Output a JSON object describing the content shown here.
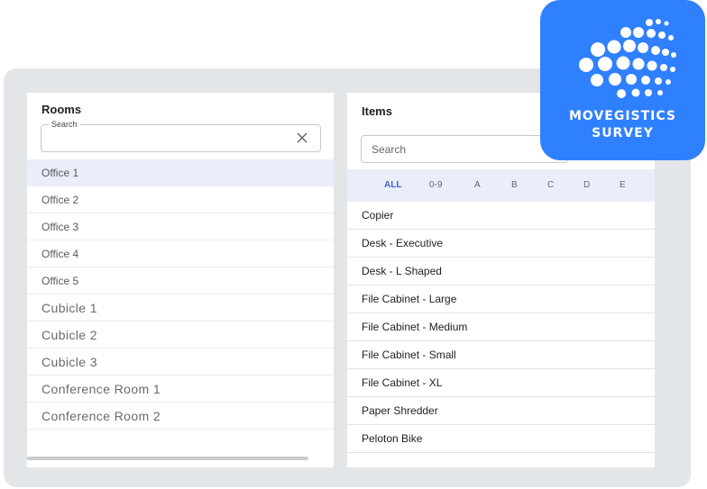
{
  "rooms_panel": {
    "title": "Rooms",
    "search_legend": "Search",
    "rooms": [
      {
        "label": "Office 1",
        "selected": true,
        "style": "small"
      },
      {
        "label": "Office 2",
        "selected": false,
        "style": "small"
      },
      {
        "label": "Office 3",
        "selected": false,
        "style": "small"
      },
      {
        "label": "Office 4",
        "selected": false,
        "style": "small"
      },
      {
        "label": "Office 5",
        "selected": false,
        "style": "small"
      },
      {
        "label": "Cubicle 1",
        "selected": false,
        "style": "big"
      },
      {
        "label": "Cubicle 2",
        "selected": false,
        "style": "big"
      },
      {
        "label": "Cubicle 3",
        "selected": false,
        "style": "big"
      },
      {
        "label": "Conference Room 1",
        "selected": false,
        "style": "big"
      },
      {
        "label": "Conference Room 2",
        "selected": false,
        "style": "big"
      }
    ]
  },
  "items_panel": {
    "title": "Items",
    "search_placeholder": "Search",
    "alpha_filters": [
      "ALL",
      "0-9",
      "A",
      "B",
      "C",
      "D",
      "E"
    ],
    "active_filter": "ALL",
    "items": [
      "Copier",
      "Desk - Executive",
      "Desk - L Shaped",
      "File Cabinet - Large",
      "File Cabinet - Medium",
      "File Cabinet - Small",
      "File Cabinet - XL",
      "Paper Shredder",
      "Peloton Bike"
    ]
  },
  "logo": {
    "line1": "MOVEGISTICS",
    "line2": "SURVEY"
  },
  "colors": {
    "accent": "#3f63c7",
    "logo_bg": "#2f80ff",
    "selected_row": "#eaeefa",
    "frame": "#e3e6e9"
  }
}
